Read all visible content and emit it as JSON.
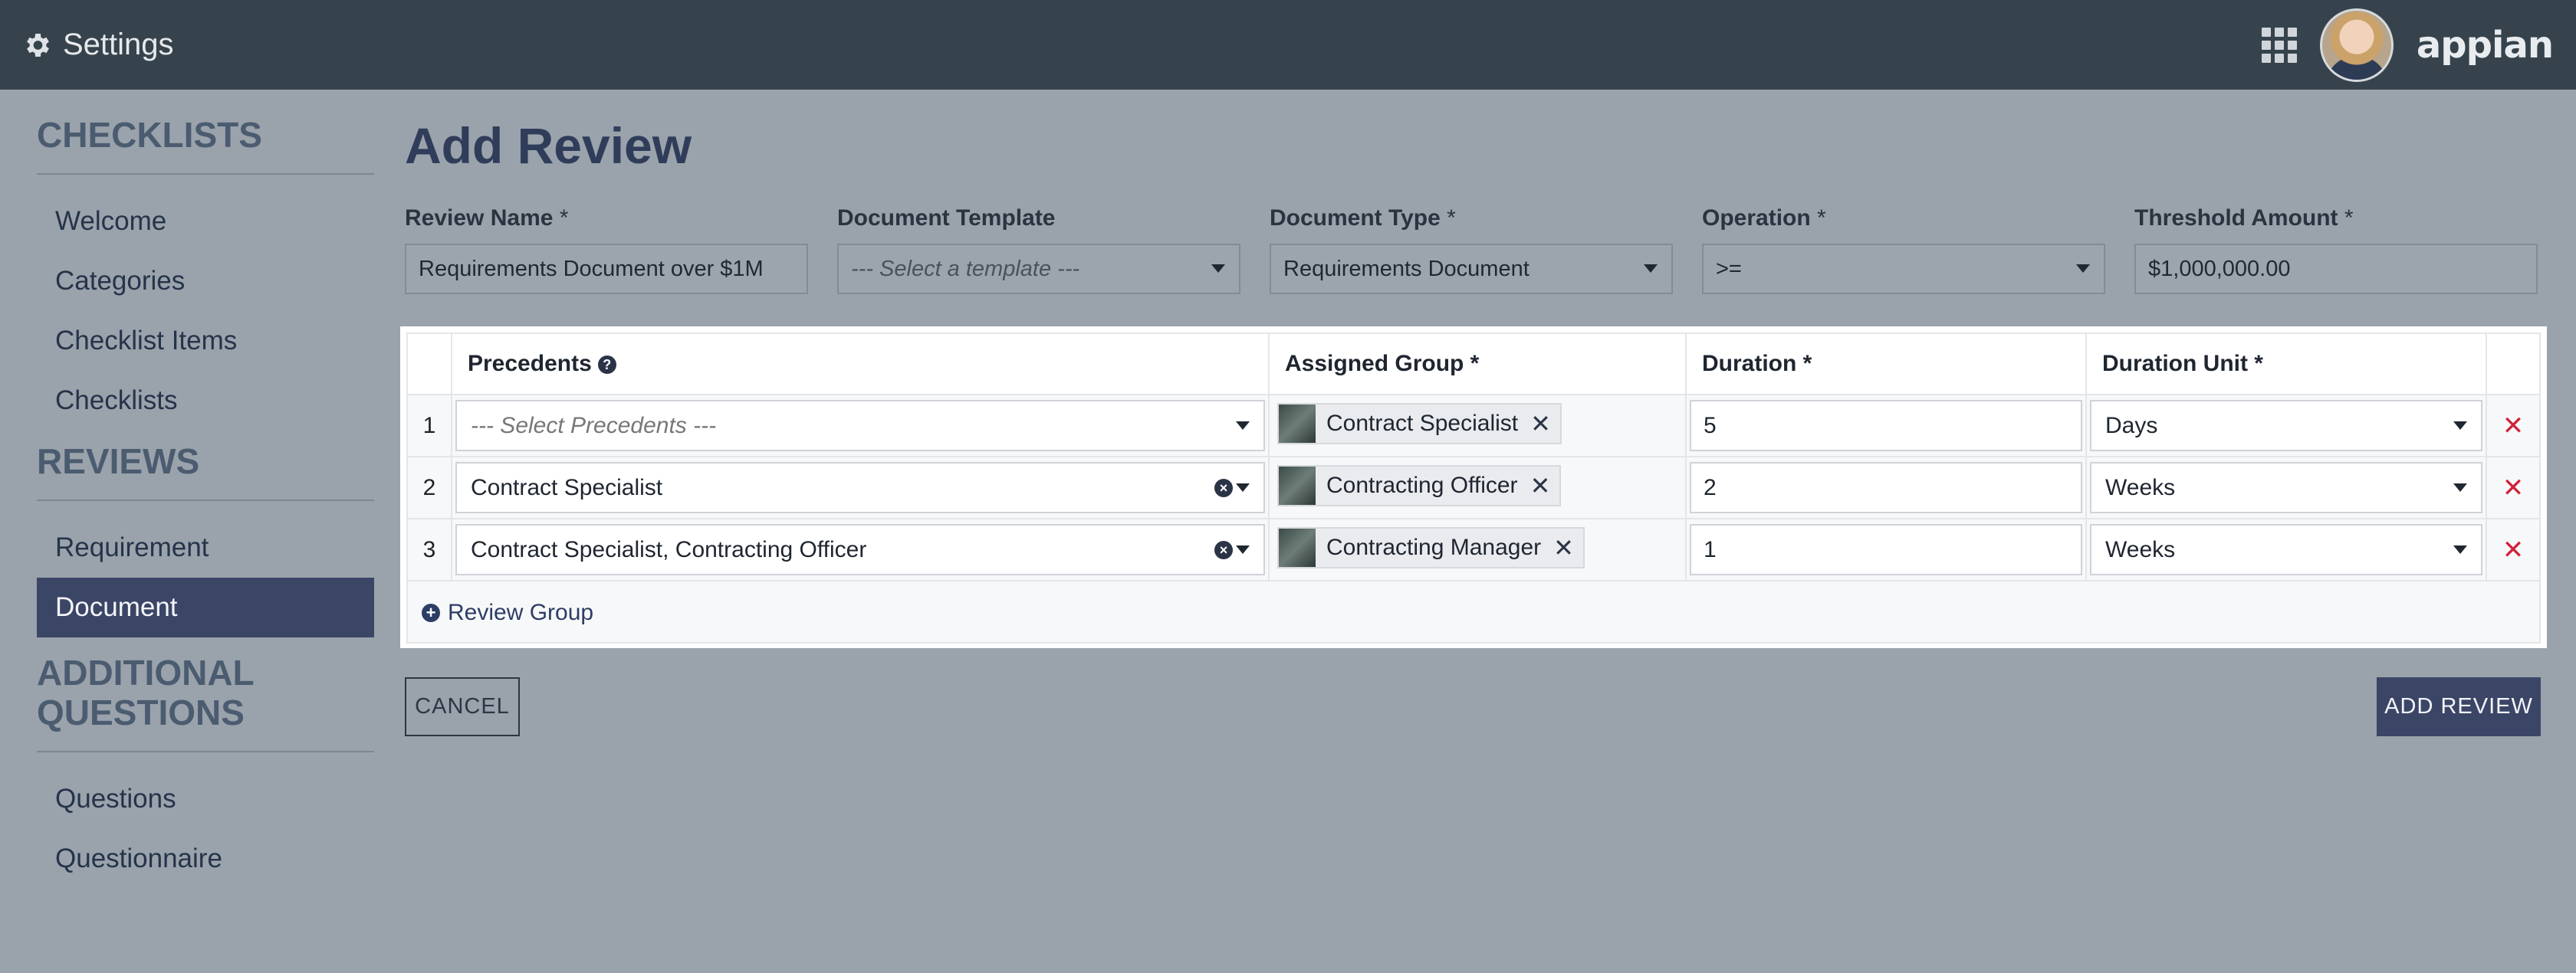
{
  "header": {
    "title": "Settings",
    "brand": "appian"
  },
  "sidebar": {
    "sections": [
      {
        "title": "CHECKLISTS",
        "items": [
          "Welcome",
          "Categories",
          "Checklist Items",
          "Checklists"
        ]
      },
      {
        "title": "REVIEWS",
        "items": [
          "Requirement",
          "Document"
        ]
      },
      {
        "title_line1": "ADDITIONAL",
        "title_line2": "QUESTIONS",
        "items": [
          "Questions",
          "Questionnaire"
        ]
      }
    ],
    "active_item": "Document"
  },
  "main": {
    "title": "Add Review",
    "fields": [
      {
        "label": "Review Name",
        "required": "*",
        "value": "Requirements Document over $1M"
      },
      {
        "label": "Document Template",
        "required": "",
        "placeholder": "--- Select a template ---"
      },
      {
        "label": "Document Type",
        "required": "*",
        "value": "Requirements Document"
      },
      {
        "label": "Operation",
        "required": "*",
        "value": ">="
      },
      {
        "label": "Threshold Amount",
        "required": "*",
        "value": "$1,000,000.00"
      }
    ]
  },
  "grid": {
    "headers": {
      "precedents": "Precedents",
      "assigned_group": "Assigned Group *",
      "duration": "Duration *",
      "duration_unit": "Duration Unit *"
    },
    "rows": [
      {
        "num": "1",
        "precedents": "--- Select Precedents ---",
        "group": "Contract Specialist",
        "duration": "5",
        "unit": "Days"
      },
      {
        "num": "2",
        "precedents": "Contract Specialist",
        "group": "Contracting Officer",
        "duration": "2",
        "unit": "Weeks"
      },
      {
        "num": "3",
        "precedents": "Contract Specialist, Contracting Officer",
        "group": "Contracting Manager",
        "duration": "1",
        "unit": "Weeks"
      }
    ],
    "add_link": "Review Group"
  },
  "buttons": {
    "cancel": "CANCEL",
    "add": "ADD REVIEW"
  },
  "colors": {
    "topbar": "#36434c",
    "background": "#9aa2ab",
    "accent": "#3b4566",
    "delete": "#d0213a"
  }
}
